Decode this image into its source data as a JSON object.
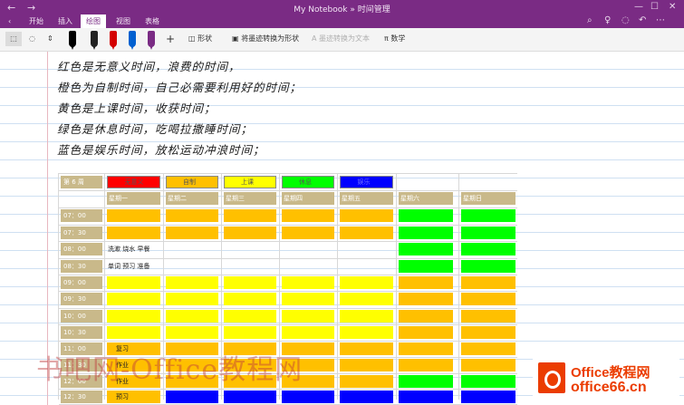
{
  "titlebar": {
    "title": "My Notebook » 时间管理"
  },
  "ribbon": {
    "tabs": [
      "开始",
      "插入",
      "绘图",
      "视图",
      "表格"
    ],
    "active_tab": "绘图"
  },
  "toolbar": {
    "shapes": "形状",
    "ink_to_shape": "将墨迹转换为形状",
    "ink_to_text": "墨迹转换为文本",
    "math": "数学"
  },
  "notes": {
    "lines": [
      "红色是无意义时间，浪费的时间，",
      "橙色为自制时间，自己必需要利用好的时间；",
      "黄色是上课时间，收获时间；",
      "绿色是休息时间，吃喝拉撒睡时间；",
      "蓝色是娱乐时间，放松运动冲浪时间；"
    ]
  },
  "legend": {
    "week_label": "第 6 周",
    "items": [
      {
        "label": "无意义",
        "color": "#ff0000"
      },
      {
        "label": "自制",
        "color": "#ffc000"
      },
      {
        "label": "上课",
        "color": "#ffff00"
      },
      {
        "label": "休息",
        "color": "#00ff00"
      },
      {
        "label": "娱乐",
        "color": "#0000ff"
      }
    ]
  },
  "days": [
    "星期一",
    "星期二",
    "星期三",
    "星期四",
    "星期五",
    "星期六",
    "星期日"
  ],
  "times": [
    "07：00",
    "07：30",
    "08：00",
    "08：30",
    "09：00",
    "09：30",
    "10：00",
    "10：30",
    "11：00",
    "11：30",
    "12：00",
    "12：30"
  ],
  "colors": {
    "O": "#ffc000",
    "Y": "#ffff00",
    "G": "#00ff00",
    "B": "#0000ff",
    "R": "#ff0000",
    "W": "#ffffff"
  },
  "schedule": [
    [
      "O",
      "O",
      "O",
      "O",
      "O",
      "G",
      "G"
    ],
    [
      "O",
      "O",
      "O",
      "O",
      "O",
      "G",
      "G"
    ],
    [
      "W",
      "W",
      "W",
      "W",
      "W",
      "G",
      "G"
    ],
    [
      "W",
      "W",
      "W",
      "W",
      "W",
      "G",
      "G"
    ],
    [
      "Y",
      "Y",
      "Y",
      "Y",
      "Y",
      "O",
      "O"
    ],
    [
      "Y",
      "Y",
      "Y",
      "Y",
      "Y",
      "O",
      "O"
    ],
    [
      "Y",
      "Y",
      "Y",
      "Y",
      "Y",
      "O",
      "O"
    ],
    [
      "Y",
      "Y",
      "Y",
      "Y",
      "Y",
      "O",
      "O"
    ],
    [
      "O",
      "O",
      "O",
      "O",
      "O",
      "O",
      "O"
    ],
    [
      "O",
      "O",
      "O",
      "O",
      "O",
      "O",
      "O"
    ],
    [
      "O",
      "O",
      "O",
      "O",
      "O",
      "G",
      "G"
    ],
    [
      "O",
      "B",
      "B",
      "B",
      "B",
      "B",
      "B"
    ]
  ],
  "cell_notes": {
    "2": "洗漱 烧水 早餐",
    "3": "单词 预习 准备",
    "8": "复习",
    "9": "作业",
    "10": "作业",
    "11": "预习"
  },
  "watermark": "书吧网-Office教程网",
  "logo": {
    "line1": "Office教程网",
    "line2": "office66.cn"
  }
}
